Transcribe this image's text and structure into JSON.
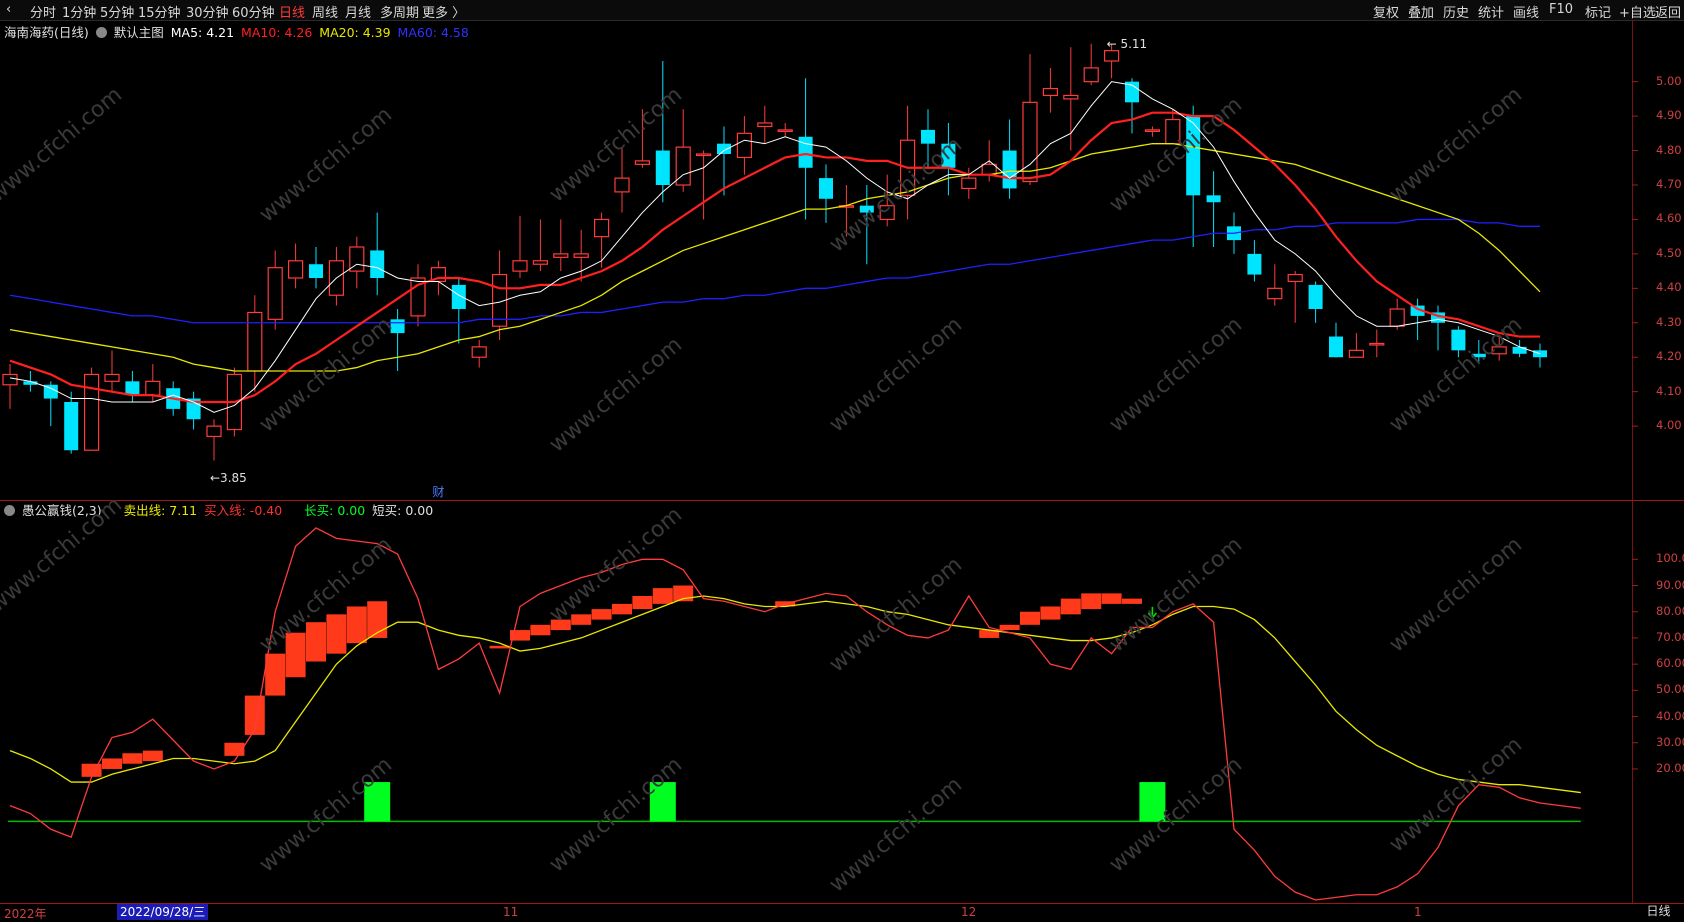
{
  "toolbar": {
    "left_tabs": [
      "分时",
      "1分钟",
      "5分钟",
      "15分钟",
      "30分钟",
      "60分钟",
      "日线",
      "周线",
      "月线",
      "多周期",
      "更多 〉"
    ],
    "active_tab": "日线",
    "right_tabs": [
      "复权",
      "叠加",
      "历史",
      "统计",
      "画线",
      "F10",
      "标记",
      "+自选",
      "返回"
    ]
  },
  "main_legend": {
    "stock": "海南海药(日线)",
    "template": "默认主图",
    "ma5": "MA5: 4.21",
    "ma10": "MA10: 4.26",
    "ma20": "MA20: 4.39",
    "ma60": "MA60: 4.58"
  },
  "sub_legend": {
    "indicator": "愚公赢钱(2,3)",
    "sell": "卖出线: 7.11",
    "buy": "买入线: -0.40",
    "long_buy": "长买: 0.00",
    "short_buy": "短买: 0.00"
  },
  "annotations": {
    "high": "5.11",
    "low": "3.85",
    "fin": "财"
  },
  "x_labels": [
    "2022年",
    "11",
    "12",
    "1"
  ],
  "cursor_date": "2022/09/28/三",
  "corner_label": "日线",
  "watermark": "www.cfchi.com",
  "colors": {
    "bg": "#000000",
    "up": "#ff3b3b",
    "down": "#00e5ff",
    "ma5": "#ffffff",
    "ma10": "#ff2020",
    "ma20": "#e8e800",
    "ma60": "#2020ff",
    "green_bar": "#00ff20"
  },
  "chart_data": [
    {
      "type": "candlestick",
      "title": "海南海药(日线)",
      "y_ticks": [
        5.0,
        4.9,
        4.8,
        4.7,
        4.6,
        4.5,
        4.4,
        4.3,
        4.2,
        4.1,
        4.0
      ],
      "ylim": [
        3.8,
        5.15
      ],
      "candles": [
        [
          4.12,
          4.15,
          4.18,
          4.05
        ],
        [
          4.13,
          4.12,
          4.16,
          4.1
        ],
        [
          4.12,
          4.08,
          4.13,
          4.0
        ],
        [
          4.07,
          3.93,
          4.1,
          3.92
        ],
        [
          3.93,
          4.15,
          4.17,
          3.93
        ],
        [
          4.13,
          4.15,
          4.22,
          4.1
        ],
        [
          4.13,
          4.09,
          4.16,
          4.07
        ],
        [
          4.09,
          4.13,
          4.18,
          4.07
        ],
        [
          4.11,
          4.05,
          4.13,
          4.03
        ],
        [
          4.08,
          4.02,
          4.1,
          3.99
        ],
        [
          3.97,
          4.0,
          4.02,
          3.9
        ],
        [
          3.99,
          4.15,
          4.17,
          3.97
        ],
        [
          4.16,
          4.33,
          4.38,
          4.1
        ],
        [
          4.31,
          4.46,
          4.51,
          4.28
        ],
        [
          4.43,
          4.48,
          4.53,
          4.4
        ],
        [
          4.47,
          4.43,
          4.52,
          4.4
        ],
        [
          4.38,
          4.48,
          4.52,
          4.35
        ],
        [
          4.45,
          4.52,
          4.55,
          4.4
        ],
        [
          4.51,
          4.43,
          4.62,
          4.38
        ],
        [
          4.31,
          4.27,
          4.34,
          4.16
        ],
        [
          4.32,
          4.43,
          4.47,
          4.29
        ],
        [
          4.42,
          4.46,
          4.48,
          4.38
        ],
        [
          4.41,
          4.34,
          4.43,
          4.24
        ],
        [
          4.2,
          4.23,
          4.25,
          4.17
        ],
        [
          4.29,
          4.44,
          4.51,
          4.25
        ],
        [
          4.45,
          4.48,
          4.61,
          4.43
        ],
        [
          4.47,
          4.48,
          4.6,
          4.45
        ],
        [
          4.49,
          4.5,
          4.6,
          4.45
        ],
        [
          4.49,
          4.5,
          4.57,
          4.42
        ],
        [
          4.55,
          4.6,
          4.62,
          4.46
        ],
        [
          4.68,
          4.72,
          4.81,
          4.62
        ],
        [
          4.76,
          4.77,
          4.92,
          4.75
        ],
        [
          4.8,
          4.7,
          5.06,
          4.65
        ],
        [
          4.7,
          4.81,
          4.92,
          4.68
        ],
        [
          4.79,
          4.79,
          4.8,
          4.6
        ],
        [
          4.82,
          4.79,
          4.87,
          4.67
        ],
        [
          4.78,
          4.85,
          4.9,
          4.73
        ],
        [
          4.87,
          4.88,
          4.93,
          4.82
        ],
        [
          4.86,
          4.86,
          4.88,
          4.84
        ],
        [
          4.84,
          4.75,
          5.01,
          4.6
        ],
        [
          4.72,
          4.66,
          4.76,
          4.59
        ],
        [
          4.64,
          4.64,
          4.7,
          4.55
        ],
        [
          4.64,
          4.62,
          4.7,
          4.47
        ],
        [
          4.6,
          4.64,
          4.73,
          4.58
        ],
        [
          4.67,
          4.83,
          4.93,
          4.6
        ],
        [
          4.86,
          4.82,
          4.92,
          4.75
        ],
        [
          4.82,
          4.75,
          4.88,
          4.67
        ],
        [
          4.69,
          4.72,
          4.75,
          4.66
        ],
        [
          4.73,
          4.76,
          4.83,
          4.71
        ],
        [
          4.8,
          4.69,
          4.89,
          4.66
        ],
        [
          4.71,
          4.94,
          5.08,
          4.7
        ],
        [
          4.96,
          4.98,
          5.04,
          4.91
        ],
        [
          4.95,
          4.96,
          5.1,
          4.8
        ],
        [
          5.0,
          5.04,
          5.11,
          4.99
        ],
        [
          5.06,
          5.09,
          5.11,
          5.01
        ],
        [
          5.0,
          4.94,
          5.01,
          4.85
        ],
        [
          4.86,
          4.86,
          4.87,
          4.84
        ],
        [
          4.82,
          4.89,
          4.92,
          4.82
        ],
        [
          4.9,
          4.67,
          4.93,
          4.52
        ],
        [
          4.67,
          4.65,
          4.74,
          4.52
        ],
        [
          4.58,
          4.54,
          4.62,
          4.5
        ],
        [
          4.5,
          4.44,
          4.54,
          4.42
        ],
        [
          4.37,
          4.4,
          4.47,
          4.35
        ],
        [
          4.42,
          4.44,
          4.45,
          4.3
        ],
        [
          4.41,
          4.34,
          4.42,
          4.3
        ],
        [
          4.26,
          4.2,
          4.3,
          4.2
        ],
        [
          4.2,
          4.22,
          4.27,
          4.2
        ],
        [
          4.24,
          4.24,
          4.28,
          4.2
        ],
        [
          4.29,
          4.34,
          4.37,
          4.28
        ],
        [
          4.35,
          4.32,
          4.37,
          4.25
        ],
        [
          4.33,
          4.3,
          4.35,
          4.22
        ],
        [
          4.28,
          4.22,
          4.29,
          4.2
        ],
        [
          4.21,
          4.2,
          4.25,
          4.18
        ],
        [
          4.21,
          4.23,
          4.26,
          4.19
        ],
        [
          4.23,
          4.21,
          4.25,
          4.2
        ],
        [
          4.22,
          4.2,
          4.24,
          4.17
        ]
      ],
      "ma5": [
        4.14,
        4.13,
        4.11,
        4.08,
        4.08,
        4.07,
        4.07,
        4.07,
        4.09,
        4.07,
        4.04,
        4.06,
        4.11,
        4.19,
        4.28,
        4.37,
        4.43,
        4.47,
        4.46,
        4.43,
        4.42,
        4.42,
        4.38,
        4.35,
        4.36,
        4.38,
        4.39,
        4.43,
        4.45,
        4.48,
        4.55,
        4.62,
        4.68,
        4.73,
        4.75,
        4.8,
        4.83,
        4.82,
        4.84,
        4.82,
        4.81,
        4.77,
        4.72,
        4.68,
        4.66,
        4.7,
        4.73,
        4.73,
        4.77,
        4.72,
        4.76,
        4.82,
        4.85,
        4.93,
        5.0,
        4.99,
        4.95,
        4.92,
        4.88,
        4.81,
        4.71,
        4.62,
        4.54,
        4.5,
        4.45,
        4.38,
        4.32,
        4.29,
        4.29,
        4.3,
        4.31,
        4.3,
        4.28,
        4.26,
        4.23,
        4.21
      ],
      "ma10": [
        4.19,
        4.17,
        4.15,
        4.12,
        4.11,
        4.1,
        4.09,
        4.09,
        4.08,
        4.07,
        4.07,
        4.07,
        4.09,
        4.13,
        4.18,
        4.21,
        4.25,
        4.29,
        4.33,
        4.37,
        4.41,
        4.43,
        4.43,
        4.42,
        4.4,
        4.4,
        4.41,
        4.41,
        4.43,
        4.45,
        4.48,
        4.52,
        4.57,
        4.61,
        4.65,
        4.69,
        4.72,
        4.75,
        4.78,
        4.79,
        4.78,
        4.78,
        4.77,
        4.77,
        4.75,
        4.75,
        4.75,
        4.73,
        4.73,
        4.72,
        4.72,
        4.73,
        4.77,
        4.83,
        4.88,
        4.89,
        4.91,
        4.91,
        4.9,
        4.9,
        4.86,
        4.81,
        4.76,
        4.7,
        4.63,
        4.55,
        4.48,
        4.42,
        4.38,
        4.34,
        4.32,
        4.31,
        4.29,
        4.27,
        4.26,
        4.26
      ],
      "ma20": [
        4.28,
        4.27,
        4.26,
        4.25,
        4.24,
        4.23,
        4.22,
        4.21,
        4.2,
        4.18,
        4.17,
        4.16,
        4.16,
        4.16,
        4.16,
        4.16,
        4.16,
        4.17,
        4.19,
        4.2,
        4.21,
        4.23,
        4.25,
        4.26,
        4.28,
        4.29,
        4.31,
        4.33,
        4.35,
        4.38,
        4.42,
        4.45,
        4.48,
        4.51,
        4.53,
        4.55,
        4.57,
        4.59,
        4.61,
        4.63,
        4.63,
        4.64,
        4.66,
        4.67,
        4.68,
        4.7,
        4.72,
        4.73,
        4.73,
        4.74,
        4.74,
        4.75,
        4.77,
        4.79,
        4.8,
        4.81,
        4.82,
        4.82,
        4.81,
        4.8,
        4.79,
        4.78,
        4.77,
        4.76,
        4.74,
        4.72,
        4.7,
        4.68,
        4.66,
        4.64,
        4.62,
        4.6,
        4.56,
        4.51,
        4.45,
        4.39
      ],
      "ma60": [
        4.38,
        4.37,
        4.36,
        4.35,
        4.34,
        4.33,
        4.32,
        4.32,
        4.31,
        4.3,
        4.3,
        4.3,
        4.3,
        4.3,
        4.3,
        4.3,
        4.3,
        4.3,
        4.3,
        4.3,
        4.3,
        4.3,
        4.3,
        4.31,
        4.31,
        4.31,
        4.32,
        4.32,
        4.33,
        4.33,
        4.34,
        4.35,
        4.36,
        4.36,
        4.37,
        4.37,
        4.38,
        4.38,
        4.39,
        4.4,
        4.4,
        4.41,
        4.42,
        4.43,
        4.43,
        4.44,
        4.45,
        4.46,
        4.47,
        4.47,
        4.48,
        4.49,
        4.5,
        4.51,
        4.52,
        4.53,
        4.54,
        4.54,
        4.55,
        4.56,
        4.56,
        4.57,
        4.57,
        4.58,
        4.58,
        4.59,
        4.59,
        4.59,
        4.59,
        4.6,
        4.6,
        4.6,
        4.59,
        4.59,
        4.58,
        4.58
      ]
    },
    {
      "type": "line",
      "title": "愚公赢钱(2,3)",
      "y_ticks": [
        100,
        90,
        80,
        70,
        60,
        50,
        40,
        30,
        20
      ],
      "ylim": [
        -30,
        115
      ],
      "red_line": [
        6,
        3,
        -3,
        -6,
        17,
        32,
        34,
        39,
        31,
        23,
        20,
        23,
        35,
        80,
        105,
        112,
        108,
        107,
        106,
        102,
        85,
        58,
        62,
        68,
        49,
        82,
        87,
        90,
        93,
        95,
        98,
        100,
        100,
        96,
        85,
        84,
        82,
        80,
        83,
        85,
        87,
        86,
        80,
        75,
        71,
        70,
        73,
        86,
        74,
        72,
        70,
        60,
        58,
        70,
        64,
        74,
        74,
        80,
        83,
        76,
        -3,
        -11,
        -21,
        -27,
        -30,
        -29,
        -28,
        -28,
        -25,
        -20,
        -10,
        6,
        14,
        13,
        9,
        7,
        6,
        5
      ],
      "yellow_line": [
        27,
        24,
        20,
        15,
        15,
        18,
        20,
        22,
        24,
        24,
        23,
        22,
        23,
        27,
        38,
        49,
        60,
        67,
        72,
        76,
        76,
        73,
        71,
        70,
        68,
        65,
        66,
        68,
        70,
        73,
        76,
        79,
        82,
        85,
        86,
        85,
        83,
        82,
        82,
        83,
        84,
        83,
        82,
        80,
        79,
        77,
        75,
        74,
        73,
        72,
        71,
        70,
        69,
        69,
        70,
        72,
        75,
        79,
        82,
        82,
        81,
        77,
        70,
        61,
        52,
        42,
        35,
        29,
        25,
        21,
        18,
        16,
        15,
        14,
        14,
        13,
        12,
        11
      ],
      "sell_boxes": [
        [
          4,
          17,
          22
        ],
        [
          5,
          20,
          24
        ],
        [
          6,
          22,
          26
        ],
        [
          7,
          23,
          27
        ],
        [
          11,
          25,
          30
        ],
        [
          12,
          33,
          48
        ],
        [
          13,
          48,
          64
        ],
        [
          14,
          55,
          72
        ],
        [
          15,
          61,
          76
        ],
        [
          16,
          64,
          79
        ],
        [
          17,
          68,
          82
        ],
        [
          18,
          70,
          84
        ],
        [
          24,
          66,
          67
        ],
        [
          25,
          69,
          73
        ],
        [
          26,
          71,
          75
        ],
        [
          27,
          73,
          77
        ],
        [
          28,
          75,
          79
        ],
        [
          29,
          77,
          81
        ],
        [
          30,
          79,
          83
        ],
        [
          31,
          81,
          86
        ],
        [
          32,
          83,
          89
        ],
        [
          33,
          84,
          90
        ],
        [
          38,
          82,
          84
        ],
        [
          48,
          70,
          73
        ],
        [
          49,
          73,
          75
        ],
        [
          50,
          75,
          80
        ],
        [
          51,
          77,
          82
        ],
        [
          52,
          79,
          85
        ],
        [
          53,
          81,
          87
        ],
        [
          54,
          83,
          87
        ],
        [
          55,
          83,
          85
        ]
      ],
      "green_bars": [
        18,
        32,
        56
      ],
      "green_bar_value": 15
    }
  ]
}
